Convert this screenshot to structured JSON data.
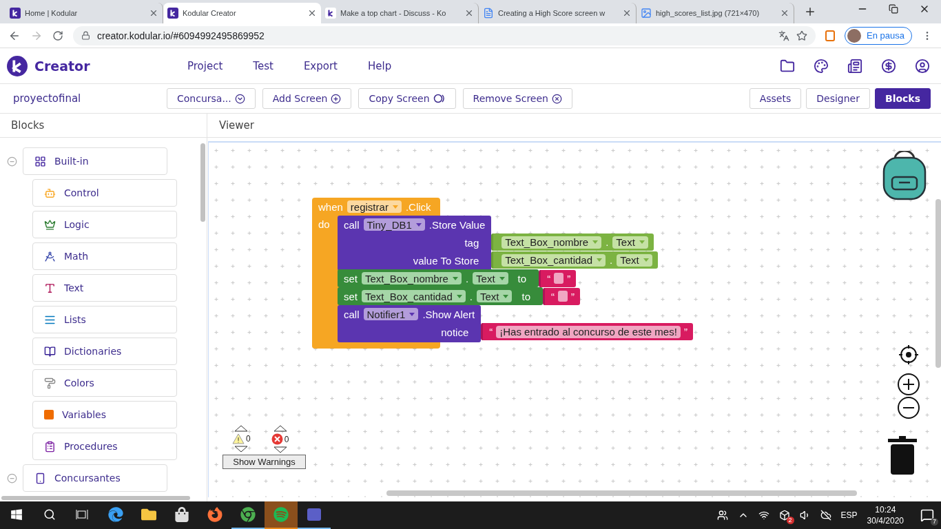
{
  "browser": {
    "tabs": [
      {
        "title": "Home | Kodular",
        "kind": "kodular",
        "selected": false
      },
      {
        "title": "Kodular Creator",
        "kind": "kodular",
        "selected": true
      },
      {
        "title": "Make a top chart - Discuss - Ko",
        "kind": "discuss",
        "selected": false
      },
      {
        "title": "Creating a High Score screen w",
        "kind": "docs",
        "selected": false
      },
      {
        "title": "high_scores_list.jpg (721×470)",
        "kind": "image",
        "selected": false
      }
    ],
    "url": "creator.kodular.io/#6094992495869952",
    "profile_label": "En pausa"
  },
  "header": {
    "brand": "Creator",
    "menu": [
      "Project",
      "Test",
      "Export",
      "Help"
    ]
  },
  "toolbar": {
    "project": "proyectofinal",
    "screen_buttons": [
      {
        "label": "Concursa...",
        "kind": "dropdown"
      },
      {
        "label": "Add Screen",
        "kind": "add"
      },
      {
        "label": "Copy Screen",
        "kind": "copy"
      },
      {
        "label": "Remove Screen",
        "kind": "remove"
      }
    ],
    "views": [
      {
        "label": "Assets",
        "selected": false
      },
      {
        "label": "Designer",
        "selected": false
      },
      {
        "label": "Blocks",
        "selected": true
      }
    ]
  },
  "sidebar": {
    "title": "Blocks",
    "groups": [
      {
        "label": "Built-in",
        "kind": "builtin",
        "expanded": true,
        "children": [
          {
            "label": "Control",
            "kind": "control"
          },
          {
            "label": "Logic",
            "kind": "logic"
          },
          {
            "label": "Math",
            "kind": "math"
          },
          {
            "label": "Text",
            "kind": "text"
          },
          {
            "label": "Lists",
            "kind": "lists"
          },
          {
            "label": "Dictionaries",
            "kind": "dictionaries"
          },
          {
            "label": "Colors",
            "kind": "colors"
          },
          {
            "label": "Variables",
            "kind": "variables"
          },
          {
            "label": "Procedures",
            "kind": "procedures"
          }
        ]
      },
      {
        "label": "Concursantes",
        "kind": "screen",
        "expanded": true
      }
    ]
  },
  "viewer": {
    "title": "Viewer",
    "event": {
      "keyword": "when",
      "component": "registrar",
      "event": ".Click",
      "do": "do",
      "statements": [
        {
          "kind": "call",
          "keyword": "call",
          "component": "Tiny_DB1",
          "method": ".Store Value",
          "args": [
            {
              "label": "tag",
              "value": {
                "kind": "getter",
                "component": "Text_Box_nombre",
                "dot": ".",
                "property": "Text"
              }
            },
            {
              "label": "value To Store",
              "value": {
                "kind": "getter",
                "component": "Text_Box_cantidad",
                "dot": ".",
                "property": "Text"
              }
            }
          ]
        },
        {
          "kind": "set",
          "keyword": "set",
          "component": "Text_Box_nombre",
          "dot": ".",
          "property": "Text",
          "to": "to",
          "value": {
            "kind": "text",
            "open_quote": "“",
            "close_quote": "”"
          }
        },
        {
          "kind": "set",
          "keyword": "set",
          "component": "Text_Box_cantidad",
          "dot": ".",
          "property": "Text",
          "to": "to",
          "value": {
            "kind": "text",
            "open_quote": "“",
            "close_quote": "”"
          }
        },
        {
          "kind": "call",
          "keyword": "call",
          "component": "Notifier1",
          "method": ".Show Alert",
          "args": [
            {
              "label": "notice",
              "value": {
                "kind": "text",
                "open_quote": "“",
                "text": "¡Has entrado al concurso de este mes!",
                "close_quote": "”"
              }
            }
          ]
        }
      ]
    },
    "warnings": {
      "warning_count": "0",
      "error_count": "0",
      "button": "Show Warnings"
    }
  },
  "taskbar": {
    "apps": [
      {
        "kind": "edge",
        "running": false,
        "attention": false
      },
      {
        "kind": "explorer",
        "running": false,
        "attention": false
      },
      {
        "kind": "store",
        "running": false,
        "attention": false
      },
      {
        "kind": "firefox",
        "running": false,
        "attention": false
      },
      {
        "kind": "chrome",
        "running": true,
        "attention": false
      },
      {
        "kind": "spotify",
        "running": true,
        "attention": true
      },
      {
        "kind": "teams",
        "running": true,
        "attention": false
      }
    ],
    "tray_badge": "2",
    "language": "ESP",
    "time": "10:24",
    "date": "30/4/2020",
    "notifications": "7"
  }
}
